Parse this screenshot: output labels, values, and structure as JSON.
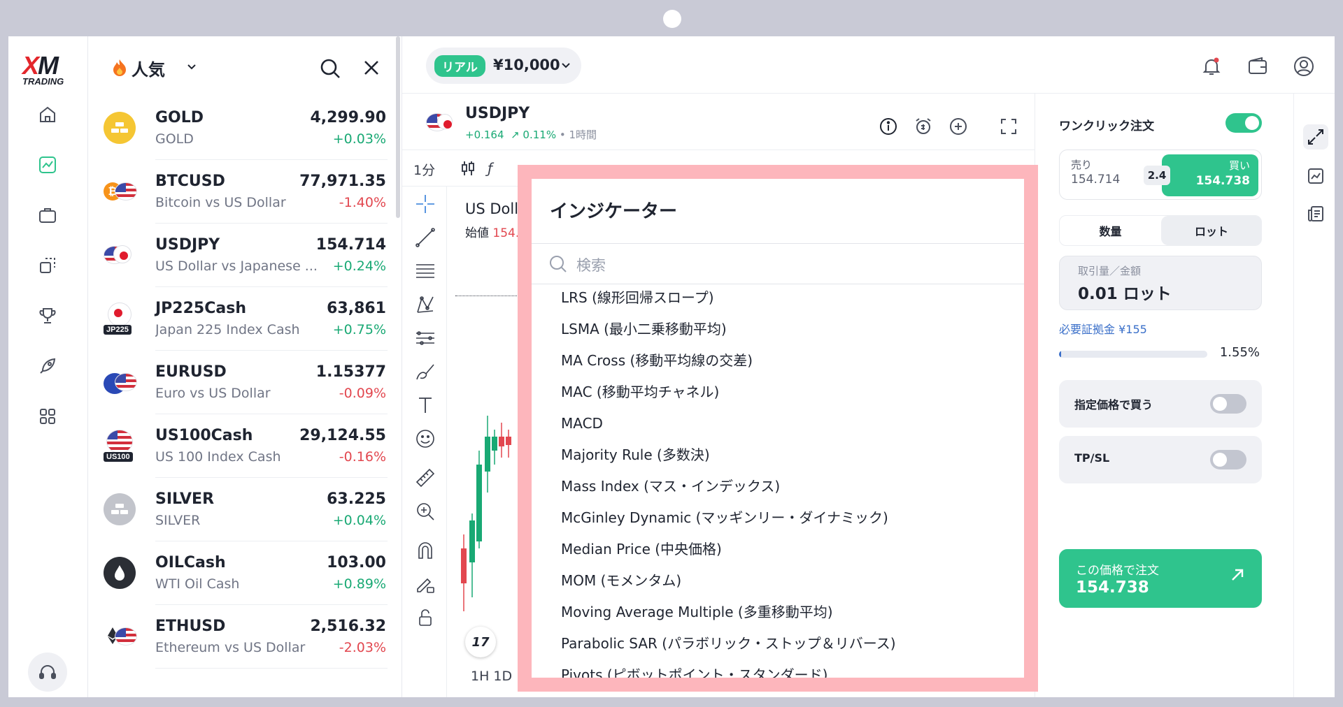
{
  "brand": {
    "logo_main": "XM",
    "logo_sub": "TRADING"
  },
  "watchlist": {
    "title": "人気",
    "items": [
      {
        "symbol": "GOLD",
        "name": "GOLD",
        "price": "4,299.90",
        "change": "+0.03%",
        "dir": "up"
      },
      {
        "symbol": "BTCUSD",
        "name": "Bitcoin vs US Dollar",
        "price": "77,971.35",
        "change": "-1.40%",
        "dir": "down"
      },
      {
        "symbol": "USDJPY",
        "name": "US Dollar vs Japanese ...",
        "price": "154.714",
        "change": "+0.24%",
        "dir": "up"
      },
      {
        "symbol": "JP225Cash",
        "name": "Japan 225 Index Cash",
        "price": "63,861",
        "change": "+0.75%",
        "dir": "up",
        "tag": "JP225"
      },
      {
        "symbol": "EURUSD",
        "name": "Euro vs US Dollar",
        "price": "1.15377",
        "change": "-0.09%",
        "dir": "down"
      },
      {
        "symbol": "US100Cash",
        "name": "US 100 Index Cash",
        "price": "29,124.55",
        "change": "-0.16%",
        "dir": "down",
        "tag": "US100"
      },
      {
        "symbol": "SILVER",
        "name": "SILVER",
        "price": "63.225",
        "change": "+0.04%",
        "dir": "up"
      },
      {
        "symbol": "OILCash",
        "name": "WTI Oil Cash",
        "price": "103.00",
        "change": "+0.89%",
        "dir": "up"
      },
      {
        "symbol": "ETHUSD",
        "name": "Ethereum vs US Dollar",
        "price": "2,516.32",
        "change": "-2.03%",
        "dir": "down"
      }
    ]
  },
  "account": {
    "badge": "リアル",
    "balance": "¥10,000"
  },
  "symbol_header": {
    "symbol": "USDJPY",
    "change_abs": "+0.164",
    "change_pct": "0.11%",
    "timeframe": "• 1時間"
  },
  "chart": {
    "timeframe": "1分",
    "symbol_label": "US Doll",
    "open_label": "始値",
    "open_value": "154.",
    "bottom_timeframes": "1H   1D",
    "tv_logo": "17"
  },
  "order_panel": {
    "one_click_label": "ワンクリック注文",
    "one_click_on": true,
    "sell_label": "売り",
    "sell_price": "154.714",
    "spread": "2.4",
    "buy_label": "買い",
    "buy_price": "154.738",
    "seg_quantity": "数量",
    "seg_lot": "ロット",
    "volume_label": "取引量／金額",
    "volume_value": "0.01 ロット",
    "margin_label": "必要証拠金 ¥155",
    "margin_pct": "1.55%",
    "margin_fraction": 0.0155,
    "limit_label": "指定価格で買う",
    "limit_on": false,
    "tpsl_label": "TP/SL",
    "tpsl_on": false,
    "order_button_label": "この価格で注文",
    "order_button_price": "154.738"
  },
  "indicator_popup": {
    "title": "インジケーター",
    "search_placeholder": "検索",
    "items": [
      "LRS (線形回帰スロープ)",
      "LSMA (最小二乗移動平均)",
      "MA Cross (移動平均線の交差)",
      "MAC (移動平均チャネル)",
      "MACD",
      "Majority Rule (多数決)",
      "Mass Index (マス・インデックス)",
      "McGinley Dynamic (マッギンリー・ダイナミック)",
      "Median Price (中央価格)",
      "MOM (モメンタム)",
      "Moving Average Multiple (多重移動平均)",
      "Parabolic SAR (パラボリック・ストップ＆リバース)",
      "Pivots (ピボットポイント・スタンダード)"
    ]
  },
  "colors": {
    "accent": "#2fc48d",
    "up": "#19a974",
    "down": "#e2474f",
    "popup_border": "#fdb6bc"
  }
}
